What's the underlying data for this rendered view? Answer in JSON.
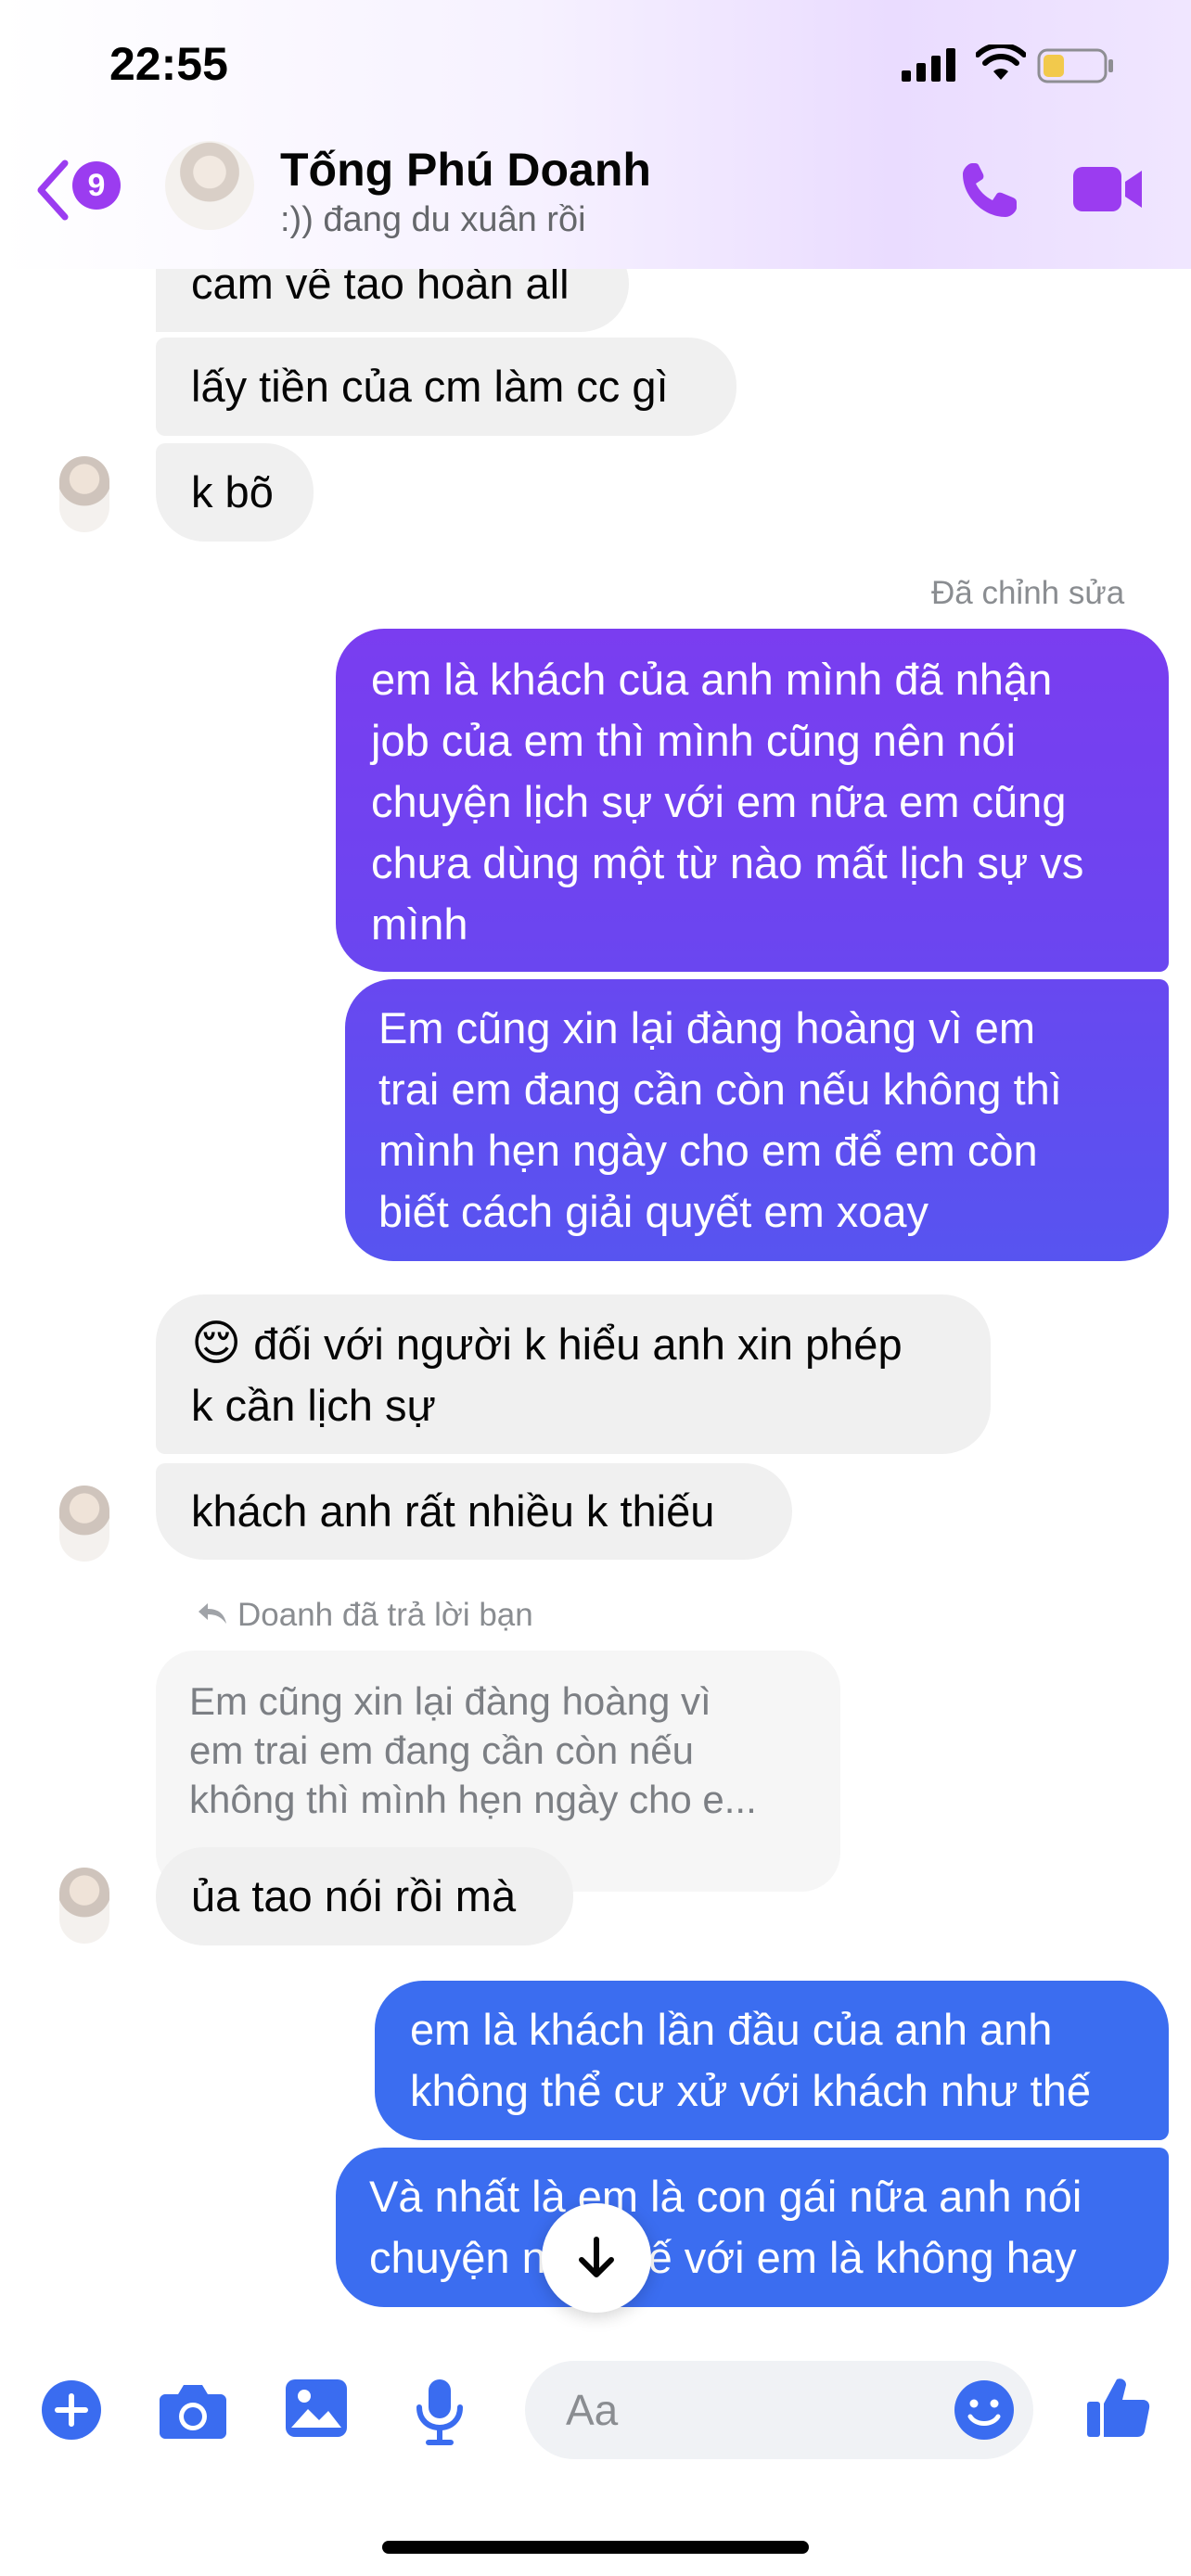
{
  "status_bar": {
    "time": "22:55"
  },
  "header": {
    "back_badge": "9",
    "contact_name": "Tống Phú Doanh",
    "contact_status": ":)) đang du xuân rồi"
  },
  "messages": [
    {
      "direction": "in",
      "text": "cam về tao hoàn all"
    },
    {
      "direction": "in",
      "text": "lấy tiền của cm làm cc gì"
    },
    {
      "direction": "in",
      "text": "k bõ"
    },
    {
      "direction": "out",
      "edited_label": "Đã chỉnh sửa",
      "lines": [
        "em là khách của anh mình đã nhận",
        "job của em thì mình cũng nên nói",
        "chuyện lịch sự với em nữa em cũng",
        "chưa dùng một từ nào mất lịch sự vs",
        "mình"
      ]
    },
    {
      "direction": "out",
      "lines": [
        "Em cũng xin lại đàng hoàng vì em",
        "trai em đang cần còn nếu không thì",
        "mình hẹn ngày cho em để em còn",
        "biết cách giải quyết em xoay"
      ]
    },
    {
      "direction": "in",
      "emoji": "😌",
      "lines": [
        "đối với người k hiểu anh xin phép",
        "k cần lịch sự"
      ]
    },
    {
      "direction": "in",
      "text": "khách anh rất nhiều k thiếu"
    },
    {
      "direction": "in",
      "reply_label": "Doanh đã trả lời bạn",
      "quote_lines": [
        "Em cũng xin lại đàng hoàng vì",
        "em trai em đang cần còn nếu",
        "không thì mình hẹn ngày cho e..."
      ],
      "text": "ủa tao nói rồi mà"
    },
    {
      "direction": "out",
      "lines": [
        "em là khách lần đầu của anh anh",
        "không thể cư xử với khách như thế"
      ]
    },
    {
      "direction": "out",
      "lines": [
        "Và nhất là em là con gái nữa anh nói",
        "chuyện như thế với em là không hay"
      ]
    }
  ],
  "composer": {
    "placeholder": "Aa"
  },
  "colors": {
    "accent": "#9b3cf0",
    "bubble_in": "#f0f0f0",
    "bubble_out_purple": "#6f43f0",
    "bubble_out_blue": "#3a6cf0"
  }
}
